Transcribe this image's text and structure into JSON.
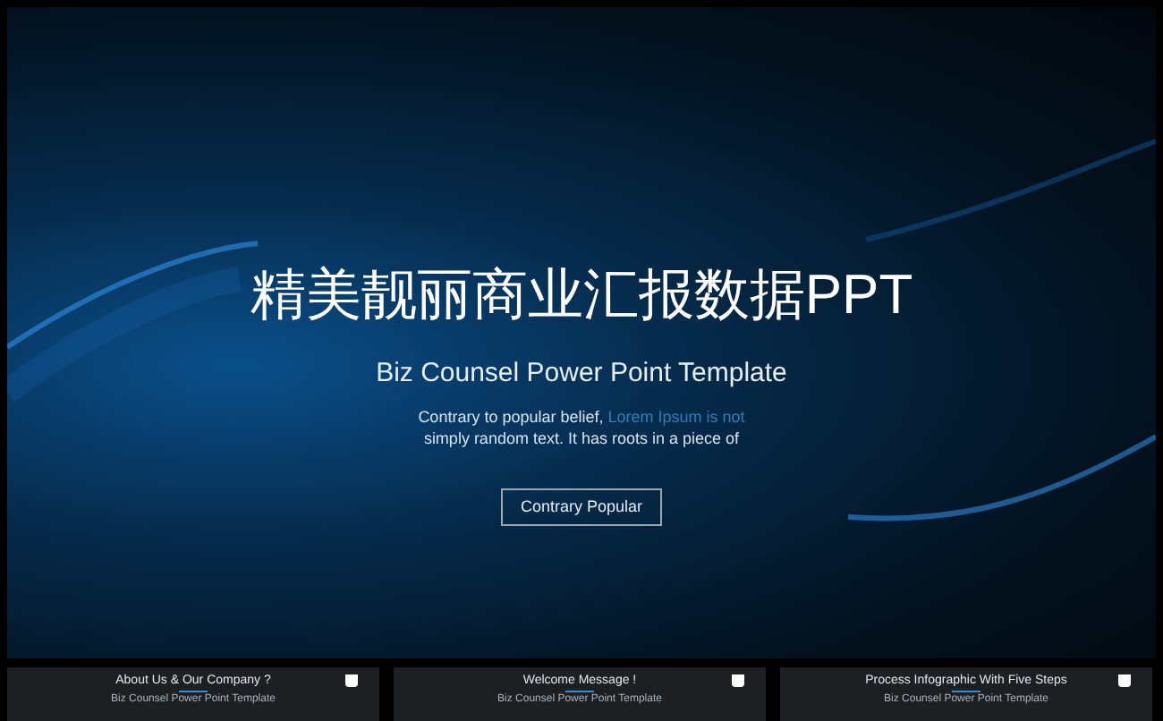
{
  "hero": {
    "title": "精美靓丽商业汇报数据PPT",
    "subtitle": "Biz Counsel Power Point Template",
    "body": "Contrary to popular belief, *Lorem Ipsum is not* simply random text. It has roots in a piece of",
    "button": "Contrary Popular"
  },
  "thumbnails": [
    {
      "title": "About Us & Our Company ?",
      "caption": "Biz Counsel Power Point Template"
    },
    {
      "title": "Welcome Message !",
      "caption": "Biz Counsel Power Point Template"
    },
    {
      "title": "Process Infographic With Five Steps",
      "caption": "Biz Counsel Power Point Template"
    }
  ]
}
